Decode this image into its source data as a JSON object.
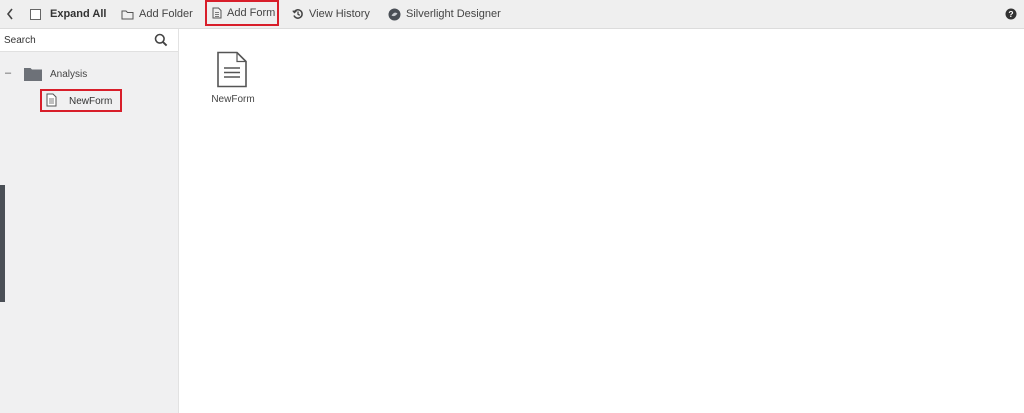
{
  "toolbar": {
    "expand_all": "Expand All",
    "add_folder": "Add Folder",
    "add_form": "Add Form",
    "view_history": "View History",
    "silverlight_designer": "Silverlight Designer"
  },
  "sidebar": {
    "search_placeholder": "Search",
    "tree": {
      "toggle": "–",
      "folder_label": "Analysis",
      "children": [
        {
          "label": "NewForm",
          "highlighted": true
        }
      ]
    }
  },
  "content": {
    "items": [
      {
        "label": "NewForm",
        "icon": "form-document-icon"
      }
    ]
  },
  "colors": {
    "highlight": "#d81e2a",
    "toolbar_bg": "#efefef",
    "sidebar_bg": "#f0f0f1",
    "handle": "#4a4f56"
  },
  "toolbar_highlighted": "add_form"
}
